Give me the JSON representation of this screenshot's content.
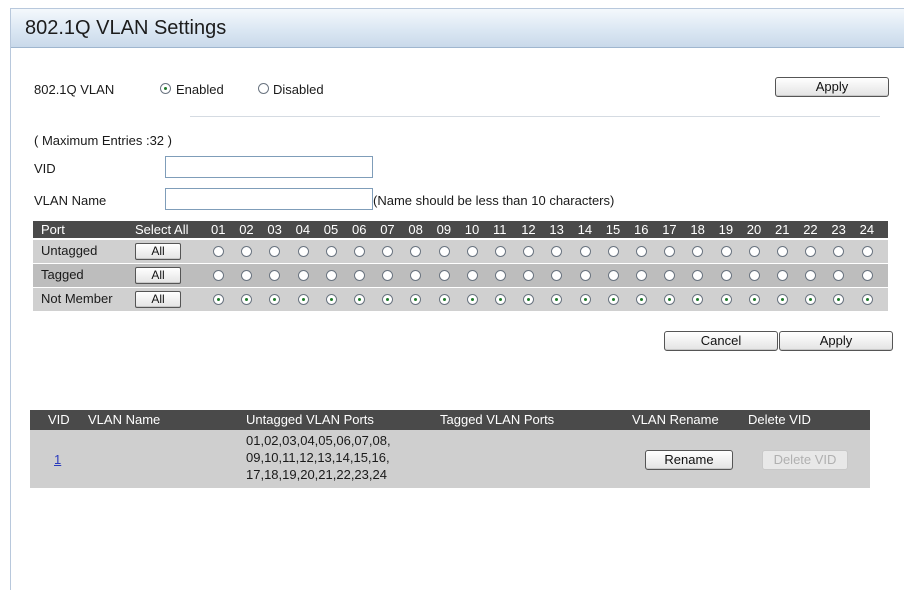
{
  "page": {
    "title": "802.1Q VLAN Settings"
  },
  "vlan_setting": {
    "label": "802.1Q VLAN",
    "enabled_label": "Enabled",
    "disabled_label": "Disabled",
    "selected": "Enabled",
    "apply_label": "Apply"
  },
  "form": {
    "max_entries": "( Maximum Entries :32 )",
    "vid_label": "VID",
    "vid_value": "",
    "vlan_name_label": "VLAN Name",
    "vlan_name_value": "",
    "vlan_name_hint": "(Name should be less than 10 characters)"
  },
  "port_grid": {
    "port_header": "Port",
    "select_all_header": "Select All",
    "ports": [
      "01",
      "02",
      "03",
      "04",
      "05",
      "06",
      "07",
      "08",
      "09",
      "10",
      "11",
      "12",
      "13",
      "14",
      "15",
      "16",
      "17",
      "18",
      "19",
      "20",
      "21",
      "22",
      "23",
      "24"
    ],
    "rows": [
      {
        "label": "Untagged",
        "button": "All",
        "selected": false
      },
      {
        "label": "Tagged",
        "button": "All",
        "selected": false
      },
      {
        "label": "Not Member",
        "button": "All",
        "selected": true
      }
    ]
  },
  "actions": {
    "cancel_label": "Cancel",
    "apply_label": "Apply"
  },
  "vlan_table": {
    "headers": {
      "vid": "VID",
      "vlan_name": "VLAN Name",
      "untagged_ports": "Untagged VLAN Ports",
      "tagged_ports": "Tagged VLAN Ports",
      "rename": "VLAN Rename",
      "delete": "Delete VID"
    },
    "rows": [
      {
        "vid": "1",
        "vlan_name": "",
        "untagged_ports_lines": [
          "01,02,03,04,05,06,07,08,",
          "09,10,11,12,13,14,15,16,",
          "17,18,19,20,21,22,23,24"
        ],
        "tagged_ports": "",
        "rename_label": "Rename",
        "delete_label": "Delete VID"
      }
    ]
  }
}
